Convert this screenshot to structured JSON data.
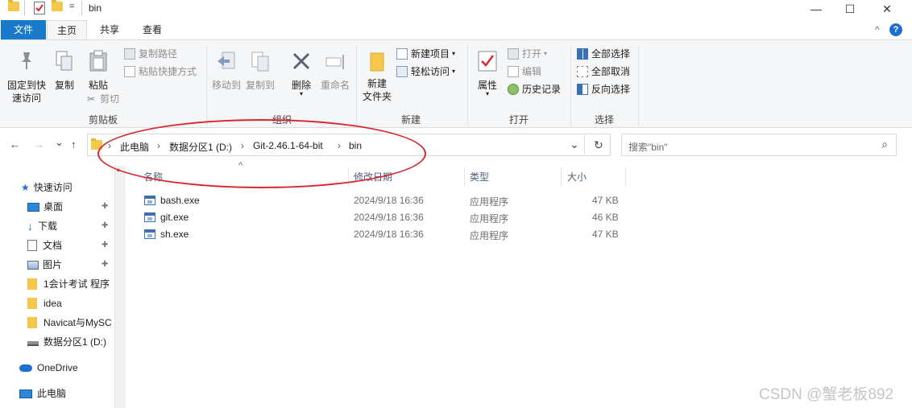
{
  "window": {
    "title": "bin",
    "qa_dropdown": "=",
    "minimize": "—",
    "maximize": "☐",
    "close": "✕"
  },
  "tabs": [
    {
      "label": "文件"
    },
    {
      "label": "主页"
    },
    {
      "label": "共享"
    },
    {
      "label": "查看"
    }
  ],
  "help": {
    "collapse": "^",
    "help": "?"
  },
  "ribbon": {
    "clipboard": {
      "label": "剪贴板",
      "pin": "固定到快\n速访问",
      "copy": "复制",
      "paste": "粘贴",
      "copy_path": "复制路径",
      "paste_shortcut": "粘贴快捷方式",
      "cut": "剪切"
    },
    "organize": {
      "label": "组织",
      "move_to": "移动到",
      "copy_to": "复制到",
      "delete": "删除",
      "rename": "重命名"
    },
    "new": {
      "label": "新建",
      "new_folder": "新建\n文件夹",
      "new_item": "新建项目",
      "easy_access": "轻松访问"
    },
    "open": {
      "label": "打开",
      "properties": "属性",
      "open": "打开",
      "edit": "编辑",
      "history": "历史记录"
    },
    "select": {
      "label": "选择",
      "select_all": "全部选择",
      "select_none": "全部取消",
      "invert": "反向选择"
    }
  },
  "address": {
    "back": "←",
    "forward": "→",
    "recent": "⌄",
    "up": "↑",
    "crumbs": [
      "此电脑",
      "数据分区1 (D:)",
      "Git-2.46.1-64-bit",
      "bin"
    ],
    "crumb_sep": "›",
    "dropdown": "⌄",
    "refresh": "↻",
    "search_placeholder": "搜索\"bin\"",
    "search_icon": "⌕"
  },
  "nav": {
    "quick_access": "快速访问",
    "items": [
      {
        "label": "桌面",
        "pinned": true
      },
      {
        "label": "下载",
        "pinned": true
      },
      {
        "label": "文档",
        "pinned": true
      },
      {
        "label": "图片",
        "pinned": true
      },
      {
        "label": "1会计考试 程序"
      },
      {
        "label": "idea"
      },
      {
        "label": "Navicat与MySC"
      },
      {
        "label": "数据分区1 (D:)"
      }
    ],
    "onedrive": "OneDrive",
    "this_pc": "此电脑",
    "pin_glyph": "📌"
  },
  "columns": {
    "name": "名称",
    "modified": "修改日期",
    "type": "类型",
    "size": "大小",
    "sort_indicator": "^"
  },
  "files": [
    {
      "name": "bash.exe",
      "modified": "2024/9/18 16:36",
      "type": "应用程序",
      "size": "47 KB"
    },
    {
      "name": "git.exe",
      "modified": "2024/9/18 16:36",
      "type": "应用程序",
      "size": "46 KB"
    },
    {
      "name": "sh.exe",
      "modified": "2024/9/18 16:36",
      "type": "应用程序",
      "size": "47 KB"
    }
  ],
  "watermark": "CSDN @蟹老板892",
  "colors": {
    "file_tab": "#1979ca",
    "annotation": "#d9262d"
  }
}
